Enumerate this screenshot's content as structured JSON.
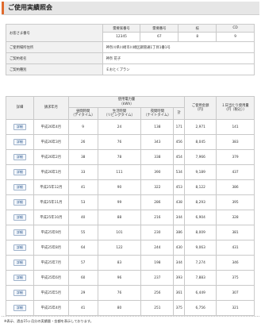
{
  "header": {
    "title": "ご使用実績照会"
  },
  "info": {
    "col_headers": [
      "需要家番号",
      "需要番号",
      "枝",
      "CD"
    ],
    "customer_label": "お客さま番号",
    "customer_values": [
      "12345",
      "67",
      "8",
      "9"
    ],
    "rows": [
      {
        "label": "ご使用場所住所",
        "value": "神奈川県川崎市川崎区鋼管通1丁目1番1号"
      },
      {
        "label": "ご契約者名",
        "value": "神奈 花子"
      },
      {
        "label": "ご契約種別",
        "value": "Ｅおとくプラン"
      }
    ]
  },
  "usage": {
    "col_detail": "詳細",
    "col_month": "請求年月",
    "col_group": "使用電力量",
    "col_group_unit": "（kWh）",
    "sub_headers": [
      {
        "line1": "昼間時間",
        "line2": "（デイタイム）"
      },
      {
        "line1": "生活時間",
        "line2": "（リビングタイム）"
      },
      {
        "line1": "夜間時間",
        "line2": "（ナイトタイム）"
      },
      {
        "line1": "計",
        "line2": ""
      }
    ],
    "col_amount_line1": "ご使用金額",
    "col_amount_line2": "（円）",
    "col_daily_line1": "１日当たり使用量",
    "col_daily_line2": "（円（税込））",
    "button_label": "詳細",
    "rows": [
      {
        "month": "平成26年4月",
        "day": "9",
        "living": "24",
        "night": "138",
        "total": "171",
        "amount": "2,971",
        "daily": "141"
      },
      {
        "month": "平成26年3月",
        "day": "26",
        "living": "76",
        "night": "343",
        "total": "456",
        "amount": "8,045",
        "daily": "383"
      },
      {
        "month": "平成26年2月",
        "day": "38",
        "living": "78",
        "night": "338",
        "total": "454",
        "amount": "7,966",
        "daily": "379"
      },
      {
        "month": "平成26年1月",
        "day": "33",
        "living": "111",
        "night": "390",
        "total": "534",
        "amount": "9,189",
        "daily": "437"
      },
      {
        "month": "平成25年12月",
        "day": "41",
        "living": "90",
        "night": "322",
        "total": "453",
        "amount": "8,122",
        "daily": "386"
      },
      {
        "month": "平成25年11月",
        "day": "53",
        "living": "99",
        "night": "286",
        "total": "438",
        "amount": "8,293",
        "daily": "395"
      },
      {
        "month": "平成25年10月",
        "day": "40",
        "living": "88",
        "night": "216",
        "total": "344",
        "amount": "6,904",
        "daily": "328"
      },
      {
        "month": "平成25年9月",
        "day": "55",
        "living": "101",
        "night": "230",
        "total": "386",
        "amount": "8,009",
        "daily": "381"
      },
      {
        "month": "平成25年8月",
        "day": "64",
        "living": "122",
        "night": "244",
        "total": "430",
        "amount": "9,063",
        "daily": "431"
      },
      {
        "month": "平成25年7月",
        "day": "57",
        "living": "83",
        "night": "198",
        "total": "344",
        "amount": "7,274",
        "daily": "346"
      },
      {
        "month": "平成25年6月",
        "day": "60",
        "living": "96",
        "night": "237",
        "total": "393",
        "amount": "7,883",
        "daily": "375"
      },
      {
        "month": "平成25年5月",
        "day": "29",
        "living": "76",
        "night": "256",
        "total": "361",
        "amount": "6,449",
        "daily": "307"
      },
      {
        "month": "平成25年4月",
        "day": "41",
        "living": "80",
        "night": "251",
        "total": "375",
        "amount": "6,756",
        "daily": "321"
      }
    ]
  },
  "footer": {
    "note": "※表示、過去15ヶ月分の実績量・金額を表示しております。"
  }
}
